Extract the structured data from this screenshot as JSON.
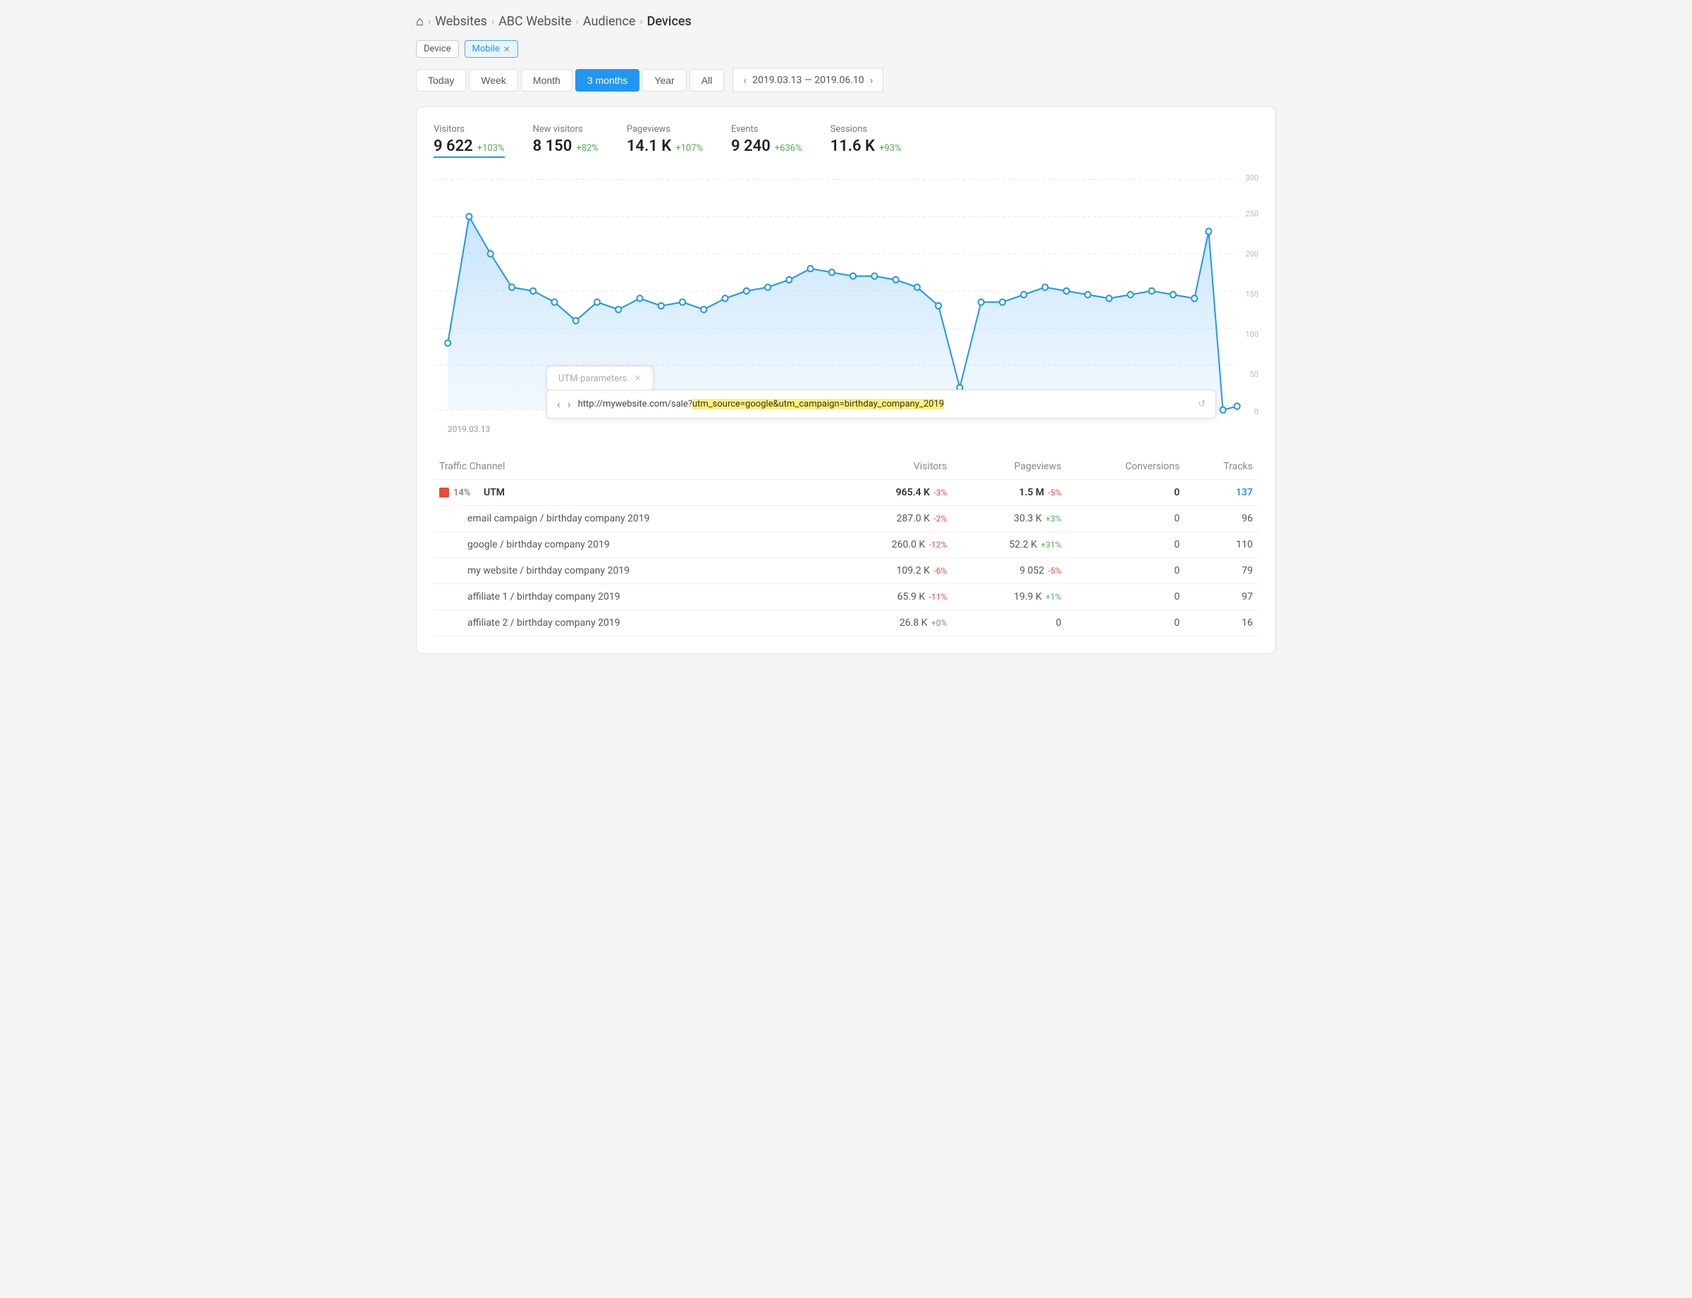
{
  "breadcrumb": {
    "items": [
      "Websites",
      "ABC Website",
      "Audience",
      "Devices"
    ]
  },
  "filters": {
    "tags": [
      {
        "label": "Device",
        "active": false,
        "closeable": false
      },
      {
        "label": "Mobile",
        "active": true,
        "closeable": true
      }
    ]
  },
  "timePeriods": {
    "buttons": [
      "Today",
      "Week",
      "Month",
      "3 months",
      "Year",
      "All"
    ],
    "active": "3 months",
    "dateRange": "2019.03.13 — 2019.06.10"
  },
  "stats": [
    {
      "label": "Visitors",
      "value": "9 622",
      "pct": "+103%",
      "pctType": "positive",
      "underline": true
    },
    {
      "label": "New visitors",
      "value": "8 150",
      "pct": "+82%",
      "pctType": "positive"
    },
    {
      "label": "Pageviews",
      "value": "14.1 K",
      "pct": "+107%",
      "pctType": "positive"
    },
    {
      "label": "Events",
      "value": "9 240",
      "pct": "+636%",
      "pctType": "positive"
    },
    {
      "label": "Sessions",
      "value": "11.6 K",
      "pct": "+93%",
      "pctType": "positive"
    }
  ],
  "chart": {
    "dateLabel": "2019.03.13",
    "yLabels": [
      "300",
      "250",
      "200",
      "150",
      "100",
      "50",
      "0"
    ],
    "utmPopup": "UTM-parameters",
    "urlBar": {
      "back": "‹",
      "forward": "›",
      "url": "http://mywebsite.com/sale?",
      "highlight": "utm_source=google&utm_campaign=birthday_company_2019"
    }
  },
  "table": {
    "headers": [
      "Traffic Channel",
      "Visitors",
      "Pageviews",
      "Conversions",
      "Tracks"
    ],
    "rows": [
      {
        "type": "main",
        "indicator": true,
        "pctLabel": "14%",
        "name": "UTM",
        "visitors": "965.4 K",
        "visitorsPct": "-3%",
        "visitorsPctType": "negative",
        "pageviews": "1.5 M",
        "pageviewsPct": "-5%",
        "pageviewsPctType": "negative",
        "conversions": "0",
        "tracks": "137",
        "tracksLink": true
      },
      {
        "type": "sub",
        "name": "email campaign / birthday company 2019",
        "visitors": "287.0 K",
        "visitorsPct": "-2%",
        "visitorsPctType": "negative",
        "pageviews": "30.3 K",
        "pageviewsPct": "+3%",
        "pageviewsPctType": "positive",
        "conversions": "0",
        "tracks": "96"
      },
      {
        "type": "sub",
        "name": "google / birthday company 2019",
        "visitors": "260.0 K",
        "visitorsPct": "-12%",
        "visitorsPctType": "negative",
        "pageviews": "52.2 K",
        "pageviewsPct": "+31%",
        "pageviewsPctType": "positive",
        "conversions": "0",
        "tracks": "110"
      },
      {
        "type": "sub",
        "name": "my website / birthday company 2019",
        "visitors": "109.2 K",
        "visitorsPct": "-6%",
        "visitorsPctType": "negative",
        "pageviews": "9 052",
        "pageviewsPct": "-5%",
        "pageviewsPctType": "negative",
        "conversions": "0",
        "tracks": "79"
      },
      {
        "type": "sub",
        "name": "affiliate 1 / birthday company 2019",
        "visitors": "65.9 K",
        "visitorsPct": "-11%",
        "visitorsPctType": "negative",
        "pageviews": "19.9 K",
        "pageviewsPct": "+1%",
        "pageviewsPctType": "positive",
        "conversions": "0",
        "tracks": "97"
      },
      {
        "type": "sub",
        "name": "affiliate 2 / birthday company 2019",
        "visitors": "26.8 K",
        "visitorsPct": "+0%",
        "visitorsPctType": "neutral",
        "pageviews": "0",
        "pageviewsPct": "",
        "pageviewsPctType": "",
        "conversions": "0",
        "tracks": "16"
      }
    ]
  }
}
